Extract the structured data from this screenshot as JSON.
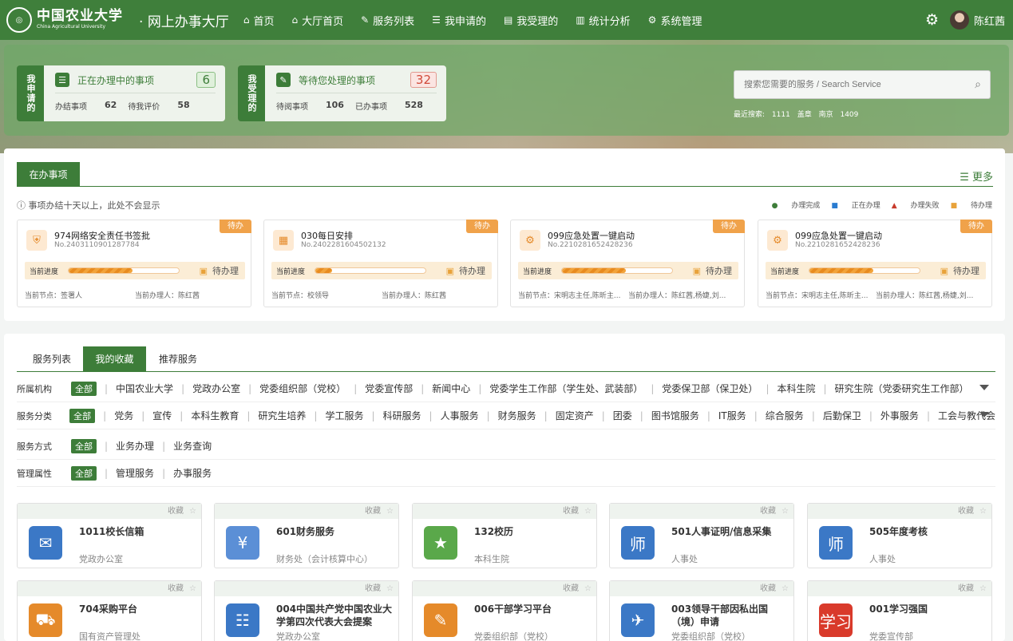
{
  "header": {
    "logo_cn": "中国农业大学",
    "logo_en": "China Agricultural University",
    "system_title": "网上办事大厅",
    "nav": [
      {
        "label": "首页",
        "icon": "home-icon"
      },
      {
        "label": "大厅首页",
        "icon": "home-icon"
      },
      {
        "label": "服务列表",
        "icon": "edit-icon"
      },
      {
        "label": "我申请的",
        "icon": "list-icon"
      },
      {
        "label": "我受理的",
        "icon": "inbox-icon"
      },
      {
        "label": "统计分析",
        "icon": "bar-chart-icon"
      },
      {
        "label": "系统管理",
        "icon": "gear-icon"
      }
    ],
    "user_name": "陈红茜"
  },
  "summary": {
    "applied": {
      "tag": "我申请的",
      "title": "正在办理中的事项",
      "count": "6",
      "items": [
        {
          "label": "办结事项",
          "value": "62"
        },
        {
          "label": "待我评价",
          "value": "58"
        }
      ]
    },
    "accepted": {
      "tag": "我受理的",
      "title": "等待您处理的事项",
      "count": "32",
      "items": [
        {
          "label": "待阅事项",
          "value": "106"
        },
        {
          "label": "已办事项",
          "value": "528"
        }
      ]
    }
  },
  "search": {
    "placeholder": "搜索您需要的服务 / Search Service",
    "recent_label": "最近搜索:",
    "recent": [
      "1111",
      "盖章",
      "南京",
      "1409"
    ]
  },
  "in_progress": {
    "tab": "在办事项",
    "more": "更多",
    "notice": "事项办结十天以上，此处不会显示",
    "legend": [
      "办理完成",
      "正在办理",
      "办理失败",
      "待办理"
    ],
    "tasks": [
      {
        "badge": "待办",
        "title": "974网络安全责任书签批",
        "no": "No.2403110901287784",
        "progress_label": "当前进度",
        "progress": 0.58,
        "status": "待办理",
        "node": "当前节点：签署人",
        "handler": "当前办理人：陈红茜"
      },
      {
        "badge": "待办",
        "title": "030每日安排",
        "no": "No.2402281604502132",
        "progress_label": "当前进度",
        "progress": 0.15,
        "status": "待办理",
        "node": "当前节点：校领导",
        "handler": "当前办理人：陈红茜"
      },
      {
        "badge": "待办",
        "title": "099应急处置一键启动",
        "no": "No.2210281652428236",
        "progress_label": "当前进度",
        "progress": 0.58,
        "status": "待办理",
        "node": "当前节点：宋明志主任,陈昕主...",
        "handler": "当前办理人：陈红茜,杨婕,刘..."
      },
      {
        "badge": "待办",
        "title": "099应急处置一键启动",
        "no": "No.2210281652428236",
        "progress_label": "当前进度",
        "progress": 0.58,
        "status": "待办理",
        "node": "当前节点：宋明志主任,陈昕主...",
        "handler": "当前办理人：陈红茜,杨婕,刘..."
      }
    ]
  },
  "services": {
    "tabs": [
      "服务列表",
      "我的收藏",
      "推荐服务"
    ],
    "active_tab": "我的收藏",
    "filters": [
      {
        "label": "所属机构",
        "all": "全部",
        "options": [
          "中国农业大学",
          "党政办公室",
          "党委组织部（党校）",
          "党委宣传部",
          "新闻中心",
          "党委学生工作部（学生处、武装部）",
          "党委保卫部（保卫处）",
          "本科生院",
          "研究生院（党委研究生工作部）"
        ],
        "expandable": true
      },
      {
        "label": "服务分类",
        "all": "全部",
        "options": [
          "党务",
          "宣传",
          "本科生教育",
          "研究生培养",
          "学工服务",
          "科研服务",
          "人事服务",
          "财务服务",
          "固定资产",
          "团委",
          "图书馆服务",
          "IT服务",
          "综合服务",
          "后勤保卫",
          "外事服务",
          "工会与教代会"
        ],
        "expandable": true
      },
      {
        "label": "服务方式",
        "all": "全部",
        "options": [
          "业务办理",
          "业务查询"
        ],
        "expandable": false
      },
      {
        "label": "管理属性",
        "all": "全部",
        "options": [
          "管理服务",
          "办事服务"
        ],
        "expandable": false
      }
    ],
    "fav_label": "收藏",
    "cards": [
      {
        "title": "1011校长信箱",
        "dept": "党政办公室",
        "icon": "mailbox-icon",
        "glyph": "✉",
        "color": "#3b78c6"
      },
      {
        "title": "601财务服务",
        "dept": "财务处（会计核算中心）",
        "icon": "finance-icon",
        "glyph": "¥",
        "color": "#5b8fd6"
      },
      {
        "title": "132校历",
        "dept": "本科生院",
        "icon": "calendar-icon",
        "glyph": "★",
        "color": "#5aa84a"
      },
      {
        "title": "501人事证明/信息采集",
        "dept": "人事处",
        "icon": "teacher-icon",
        "glyph": "师",
        "color": "#3b78c6"
      },
      {
        "title": "505年度考核",
        "dept": "人事处",
        "icon": "teacher-icon",
        "glyph": "师",
        "color": "#3b78c6"
      },
      {
        "title": "704采购平台",
        "dept": "国有资产管理处",
        "icon": "cart-icon",
        "glyph": "⛟",
        "color": "#e58a2a"
      },
      {
        "title": "004中国共产党中国农业大学第四次代表大会提案",
        "dept": "党政办公室",
        "icon": "meeting-icon",
        "glyph": "☷",
        "color": "#3b78c6"
      },
      {
        "title": "006干部学习平台",
        "dept": "党委组织部（党校）",
        "icon": "study-icon",
        "glyph": "✎",
        "color": "#e58a2a"
      },
      {
        "title": "003领导干部因私出国（境）申请",
        "dept": "党委组织部（党校）",
        "icon": "globe-icon",
        "glyph": "✈",
        "color": "#3b78c6"
      },
      {
        "title": "001学习强国",
        "dept": "党委宣传部",
        "icon": "xuexi-icon",
        "glyph": "学习",
        "color": "#d93a2b"
      }
    ]
  }
}
